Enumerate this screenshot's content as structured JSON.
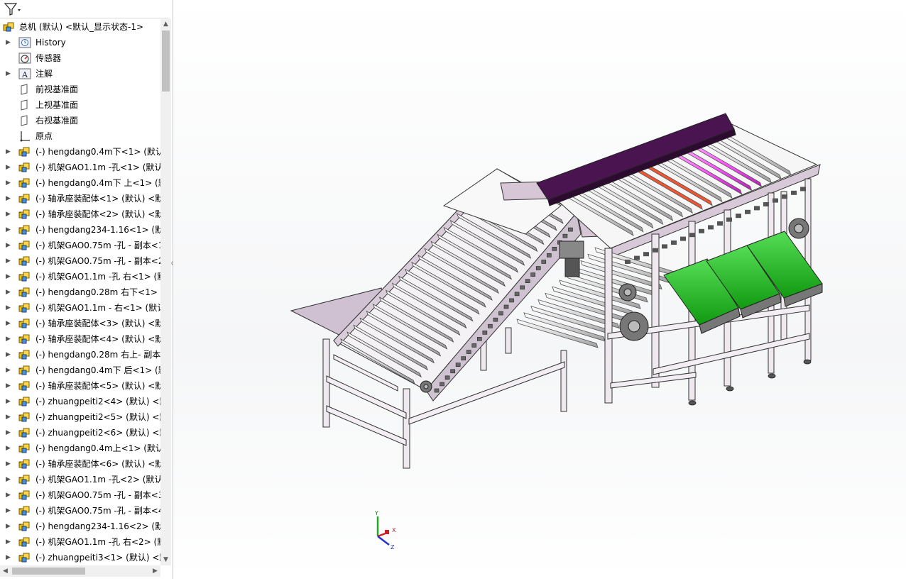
{
  "tree": {
    "root": {
      "label": "总机 (默认) <默认_显示状态-1>",
      "icon": "assembly-icon"
    },
    "items": [
      {
        "label": "History",
        "icon": "history-icon",
        "expand": true
      },
      {
        "label": "传感器",
        "icon": "sensor-icon",
        "expand": false
      },
      {
        "label": "注解",
        "icon": "annotation-icon",
        "expand": true
      },
      {
        "label": "前视基准面",
        "icon": "plane-icon",
        "expand": false
      },
      {
        "label": "上视基准面",
        "icon": "plane-icon",
        "expand": false
      },
      {
        "label": "右视基准面",
        "icon": "plane-icon",
        "expand": false
      },
      {
        "label": "原点",
        "icon": "origin-icon",
        "expand": false
      },
      {
        "label": "(-) hengdang0.4m下<1> (默认",
        "icon": "component-icon",
        "expand": true
      },
      {
        "label": "(-) 机架GAO1.1m -孔<1> (默认",
        "icon": "component-icon",
        "expand": true
      },
      {
        "label": "(-) hengdang0.4m下 上<1> (默",
        "icon": "component-icon",
        "expand": true
      },
      {
        "label": "(-) 轴承座装配体<1> (默认) <默",
        "icon": "component-icon",
        "expand": true
      },
      {
        "label": "(-) 轴承座装配体<2> (默认) <默",
        "icon": "component-icon",
        "expand": true
      },
      {
        "label": "(-) hengdang234-1.16<1> (默认",
        "icon": "component-icon",
        "expand": true
      },
      {
        "label": "(-) 机架GAO0.75m -孔 - 副本<1",
        "icon": "component-icon",
        "expand": true
      },
      {
        "label": "(-) 机架GAO0.75m -孔 - 副本<2",
        "icon": "component-icon",
        "expand": true
      },
      {
        "label": "(-) 机架GAO1.1m -孔 右<1> (默",
        "icon": "component-icon",
        "expand": true
      },
      {
        "label": "(-) hengdang0.28m 右下<1> (默",
        "icon": "component-icon",
        "expand": true
      },
      {
        "label": "(-) 机架GAO1.1m - 右<1> (默认",
        "icon": "component-icon",
        "expand": true
      },
      {
        "label": "(-) 轴承座装配体<3> (默认) <默",
        "icon": "component-icon",
        "expand": true
      },
      {
        "label": "(-) 轴承座装配体<4> (默认) <默",
        "icon": "component-icon",
        "expand": true
      },
      {
        "label": "(-) hengdang0.28m 右上- 副本",
        "icon": "component-icon",
        "expand": true
      },
      {
        "label": "(-) hengdang0.4m下 后<1> (默",
        "icon": "component-icon",
        "expand": true
      },
      {
        "label": "(-) 轴承座装配体<5> (默认) <默",
        "icon": "component-icon",
        "expand": true
      },
      {
        "label": "(-) zhuangpeiti2<4> (默认) <默",
        "icon": "component-icon",
        "expand": true
      },
      {
        "label": "(-) zhuangpeiti2<5> (默认) <默",
        "icon": "component-icon",
        "expand": true
      },
      {
        "label": "(-) zhuangpeiti2<6> (默认) <默",
        "icon": "component-icon",
        "expand": true
      },
      {
        "label": "(-) hengdang0.4m上<1> (默认",
        "icon": "component-icon",
        "expand": true
      },
      {
        "label": "(-) 轴承座装配体<6> (默认) <默",
        "icon": "component-icon",
        "expand": true
      },
      {
        "label": "(-) 机架GAO1.1m -孔<2> (默认",
        "icon": "component-icon",
        "expand": true
      },
      {
        "label": "(-) 机架GAO0.75m -孔 - 副本<3",
        "icon": "component-icon",
        "expand": true
      },
      {
        "label": "(-) 机架GAO0.75m -孔 - 副本<4",
        "icon": "component-icon",
        "expand": true
      },
      {
        "label": "(-) hengdang234-1.16<2> (默认",
        "icon": "component-icon",
        "expand": true
      },
      {
        "label": "(-) 机架GAO1.1m -孔 右<2> (默",
        "icon": "component-icon",
        "expand": true
      },
      {
        "label": "(-) zhuangpeiti3<1> (默认) <默",
        "icon": "component-icon",
        "expand": true
      }
    ]
  },
  "triad": {
    "x": "X",
    "y": "Y",
    "z": "Z"
  },
  "colors": {
    "frame": "#d9cbd9",
    "belt": "#22bb22",
    "cover": "#4a1450",
    "roller_pink": "#ff66ff",
    "roller_red": "#ee3311"
  }
}
